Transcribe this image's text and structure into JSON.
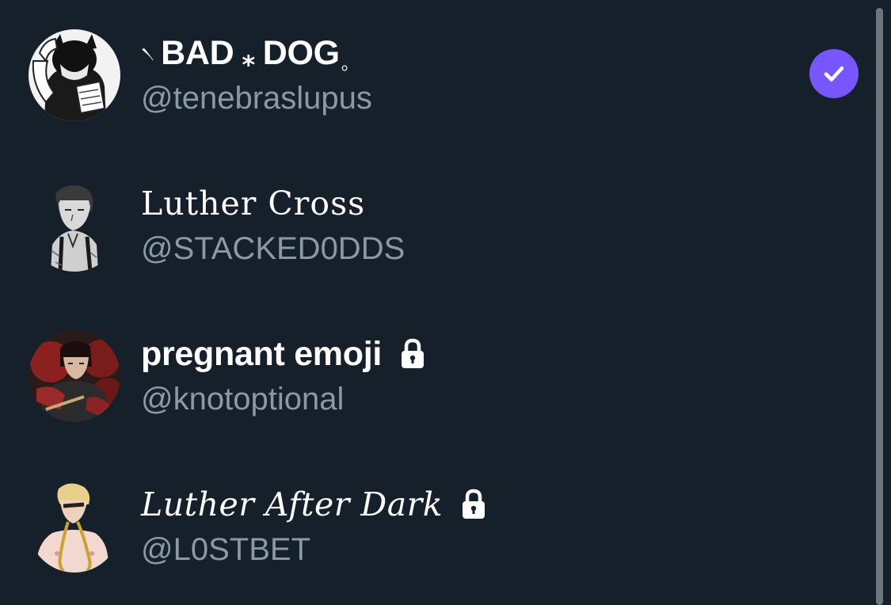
{
  "accounts": [
    {
      "display_name_prefix": "৲",
      "display_name_part1": "BAD",
      "display_name_separator": "⁎",
      "display_name_part2": "DOG",
      "display_name_suffix": "。",
      "handle": "@tenebraslupus",
      "selected": true,
      "protected": false,
      "avatar_icon": "wolf-eared-character-avatar"
    },
    {
      "display_name": "Luther Cross",
      "handle": "@STACKED0DDS",
      "selected": false,
      "protected": false,
      "avatar_icon": "suspenders-character-avatar"
    },
    {
      "display_name": "pregnant emoji",
      "handle": "@knotoptional",
      "selected": false,
      "protected": true,
      "avatar_icon": "dark-haired-character-avatar"
    },
    {
      "display_name": "Luther After Dark",
      "handle": "@L0STBET",
      "selected": false,
      "protected": true,
      "avatar_icon": "blond-chained-character-avatar"
    }
  ],
  "colors": {
    "background": "#15202b",
    "handle_text": "#8b98a5",
    "selected_badge": "#7856ff",
    "scrollbar": "#6e767d"
  },
  "icons": {
    "selected": "check-icon",
    "protected": "lock-icon"
  }
}
